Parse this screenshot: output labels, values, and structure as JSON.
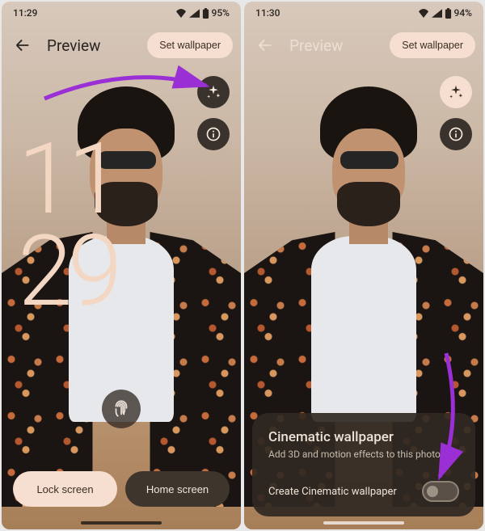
{
  "left": {
    "status": {
      "time": "11:29",
      "battery": "95%"
    },
    "header": {
      "title": "Preview",
      "set_wallpaper": "Set wallpaper"
    },
    "clock": {
      "hh": "11",
      "mm": "29"
    },
    "buttons": {
      "lock": "Lock screen",
      "home": "Home screen"
    },
    "icons": {
      "back": "back-arrow-icon",
      "sparkle": "sparkle-icon",
      "info": "info-icon",
      "fingerprint": "fingerprint-icon"
    }
  },
  "right": {
    "status": {
      "time": "11:30",
      "battery": "94%"
    },
    "header": {
      "title": "Preview",
      "set_wallpaper": "Set wallpaper"
    },
    "icons": {
      "back": "back-arrow-icon",
      "sparkle": "sparkle-icon",
      "info": "info-icon"
    },
    "sheet": {
      "title": "Cinematic wallpaper",
      "subtitle": "Add 3D and motion effects to this photo",
      "toggle_label": "Create Cinematic wallpaper",
      "toggle_on": false
    }
  },
  "annotation": {
    "arrow_color": "#9b2fd6"
  }
}
